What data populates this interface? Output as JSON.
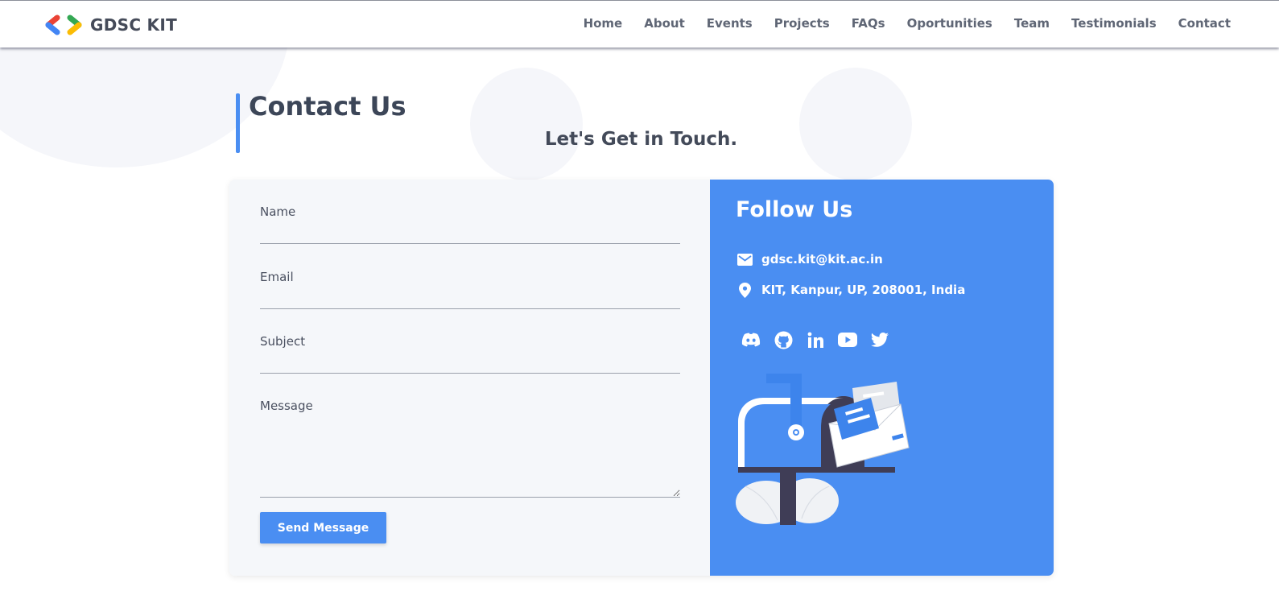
{
  "header": {
    "logo_text": "GDSC KIT",
    "nav": [
      "Home",
      "About",
      "Events",
      "Projects",
      "FAQs",
      "Oportunities",
      "Team",
      "Testimonials",
      "Contact"
    ]
  },
  "page": {
    "title": "Contact Us",
    "subtitle": "Let's Get in Touch."
  },
  "form": {
    "name_label": "Name",
    "name_value": "",
    "email_label": "Email",
    "email_value": "",
    "subject_label": "Subject",
    "subject_value": "",
    "message_label": "Message",
    "message_value": "",
    "submit_label": "Send Message"
  },
  "follow": {
    "title": "Follow Us",
    "email": "gdsc.kit@kit.ac.in",
    "address": "KIT, Kanpur, UP, 208001, India",
    "socials": [
      "discord-icon",
      "github-icon",
      "linkedin-icon",
      "youtube-icon",
      "twitter-icon"
    ]
  },
  "colors": {
    "accent": "#4a8ef2",
    "form_bg": "#f5f7fa",
    "heading": "#3c4658"
  }
}
